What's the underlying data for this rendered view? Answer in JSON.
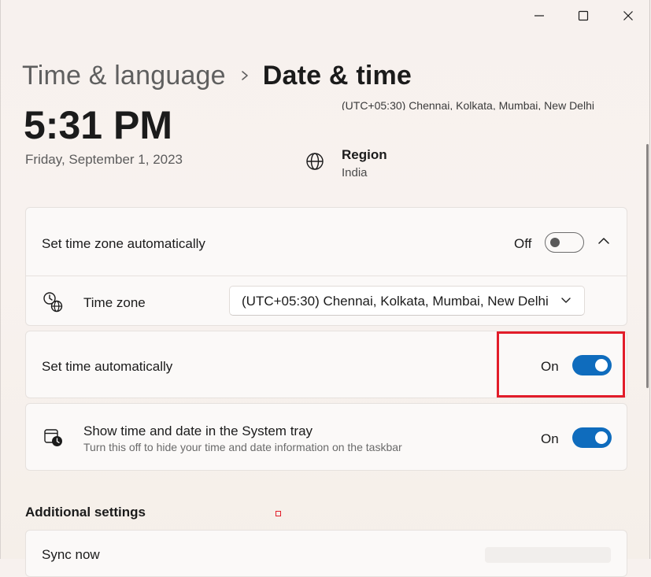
{
  "window": {
    "controls": [
      "minimize-icon",
      "maximize-icon",
      "close-icon"
    ]
  },
  "breadcrumb": {
    "parent": "Time & language",
    "separator_icon": "chevron-right-icon",
    "current": "Date & time"
  },
  "summary": {
    "time": "5:31 PM",
    "date": "Friday, September 1, 2023",
    "timezone_partial": "(UTC+05:30) Chennai, Kolkata, Mumbai, New Delhi",
    "region_icon": "globe-icon",
    "region_title": "Region",
    "region_value": "India"
  },
  "settings": {
    "auto_timezone": {
      "label": "Set time zone automatically",
      "state": "Off",
      "enabled": false,
      "expand_icon": "chevron-up-icon"
    },
    "timezone": {
      "icon": "timezone-globe-icon",
      "label": "Time zone",
      "selected": "(UTC+05:30) Chennai, Kolkata, Mumbai, New Delhi",
      "dropdown_icon": "chevron-down-icon"
    },
    "auto_time": {
      "label": "Set time automatically",
      "state": "On",
      "enabled": true
    },
    "system_tray": {
      "icon": "calendar-clock-icon",
      "label": "Show time and date in the System tray",
      "description": "Turn this off to hide your time and date information on the taskbar",
      "state": "On",
      "enabled": true
    }
  },
  "additional": {
    "heading": "Additional settings",
    "sync_label": "Sync now"
  },
  "colors": {
    "accent": "#0f6cbd",
    "highlight": "#e21d2a",
    "background": "#f7f1ee",
    "card": "#fbf9f8"
  }
}
